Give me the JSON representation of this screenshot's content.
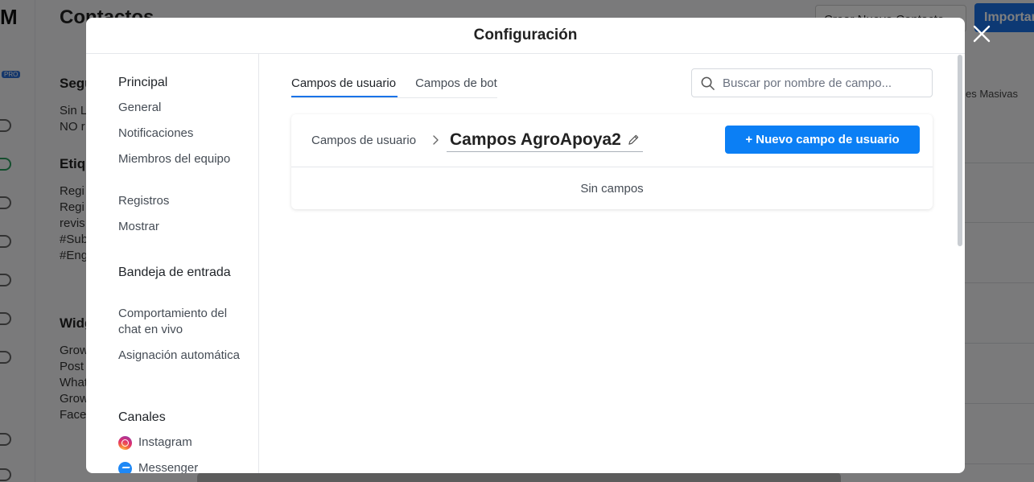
{
  "background": {
    "page_title": "Contactos",
    "create_contact_label": "Crear Nuevo Contacto",
    "import_label": "Importar",
    "pro_badge": "PRO",
    "section_1_title": "Segu",
    "section_1_lines": [
      "Sin L",
      "NO r"
    ],
    "section_2_title": "Etiqu",
    "section_2_lines": [
      "Regi",
      "Regi",
      "revis",
      "#Sub",
      "#Eng"
    ],
    "section_3_title": "Widg",
    "section_3_lines": [
      "Grow",
      "Post",
      "What",
      "Grow",
      "Face"
    ],
    "right_tab_text": "es Masivas"
  },
  "modal": {
    "title": "Configuración",
    "close_icon": "close-icon"
  },
  "sidebar": {
    "principal": {
      "title": "Principal",
      "items": [
        "General",
        "Notificaciones",
        "Miembros del equipo",
        "Registros",
        "Mostrar"
      ]
    },
    "inbox": {
      "title": "Bandeja de entrada",
      "items": [
        "Comportamiento del chat en vivo",
        "Asignación automática"
      ]
    },
    "channels": {
      "title": "Canales",
      "items": [
        {
          "label": "Instagram",
          "icon": "instagram-icon"
        },
        {
          "label": "Messenger",
          "icon": "messenger-icon"
        }
      ]
    }
  },
  "content": {
    "tabs": [
      {
        "label": "Campos de usuario",
        "active": true
      },
      {
        "label": "Campos de bot",
        "active": false
      }
    ],
    "search": {
      "placeholder": "Buscar por nombre de campo...",
      "value": ""
    },
    "card": {
      "breadcrumb_root": "Campos de usuario",
      "breadcrumb_current": "Campos AgroApoya2",
      "new_button_label": "+ Nuevo campo de usuario",
      "empty_message": "Sin campos"
    }
  },
  "colors": {
    "accent": "#0b7ff5",
    "tab_underline": "#1a73e8"
  }
}
